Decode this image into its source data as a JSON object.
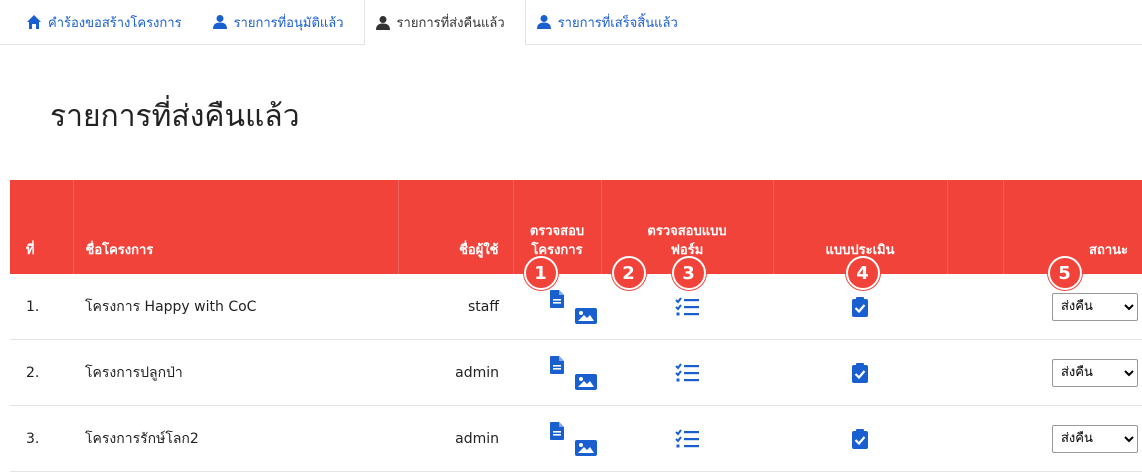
{
  "tabs": [
    {
      "label": "คำร้องขอสร้างโครงการ",
      "icon": "home-icon"
    },
    {
      "label": "รายการที่อนุมัติแล้ว",
      "icon": "user-icon"
    },
    {
      "label": "รายการที่ส่งคืนแล้ว",
      "icon": "user-icon"
    },
    {
      "label": "รายการที่เสร็จสิ้นแล้ว",
      "icon": "user-icon"
    }
  ],
  "page_title": "รายการที่ส่งคืนแล้ว",
  "table": {
    "headers": {
      "no": "ที่",
      "name": "ชื่อโครงการ",
      "user": "ชื่อผู้ใช้",
      "check_line1": "ตรวจสอบ",
      "check_line2": "โครงการ",
      "form_line1": "ตรวจสอบแบบ",
      "form_line2": "ฟอร์ม",
      "eval": "แบบประเมิน",
      "blank": "",
      "status": "สถานะ"
    },
    "badges": [
      "1",
      "2",
      "3",
      "4",
      "5"
    ],
    "rows": [
      {
        "no": "1.",
        "name": "โครงการ Happy with CoC",
        "user": "staff",
        "status": "ส่งคืน"
      },
      {
        "no": "2.",
        "name": "โครงการปลูกป่า",
        "user": "admin",
        "status": "ส่งคืน"
      },
      {
        "no": "3.",
        "name": "โครงการรักษ์โลก2",
        "user": "admin",
        "status": "ส่งคืน"
      }
    ]
  },
  "colors": {
    "header_bg": "#f2433a",
    "icon_blue": "#1a5fcf"
  }
}
